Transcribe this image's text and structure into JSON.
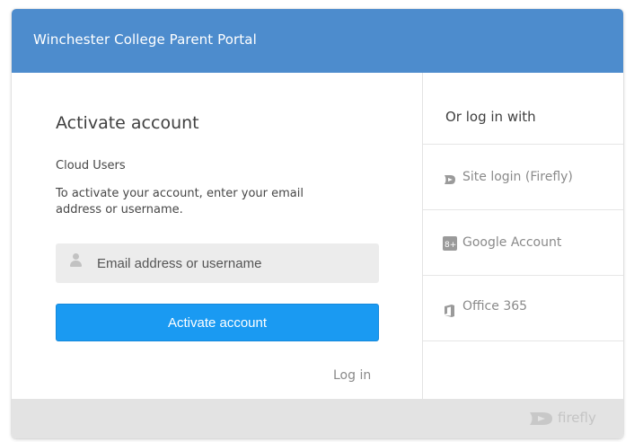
{
  "header": {
    "title": "Winchester College Parent Portal"
  },
  "left": {
    "title": "Activate account",
    "subtitle": "Cloud Users",
    "instruction": "To activate your account, enter your email address or username.",
    "input": {
      "placeholder": "Email address or username",
      "value": "",
      "icon": "user-icon"
    },
    "activate_label": "Activate account",
    "login_label": "Log in"
  },
  "right": {
    "title": "Or log in with",
    "providers": [
      {
        "label": "Site login (Firefly)",
        "icon": "firefly-icon"
      },
      {
        "label": "Google Account",
        "icon": "google-plus-icon"
      },
      {
        "label": "Office 365",
        "icon": "office-365-icon"
      }
    ]
  },
  "footer": {
    "brand": "firefly",
    "icon": "firefly-logo-icon"
  },
  "colors": {
    "header": "#4d8ccd",
    "button": "#1a9af2",
    "footer": "#e3e3e3",
    "muted_text": "#8a8a8a"
  }
}
